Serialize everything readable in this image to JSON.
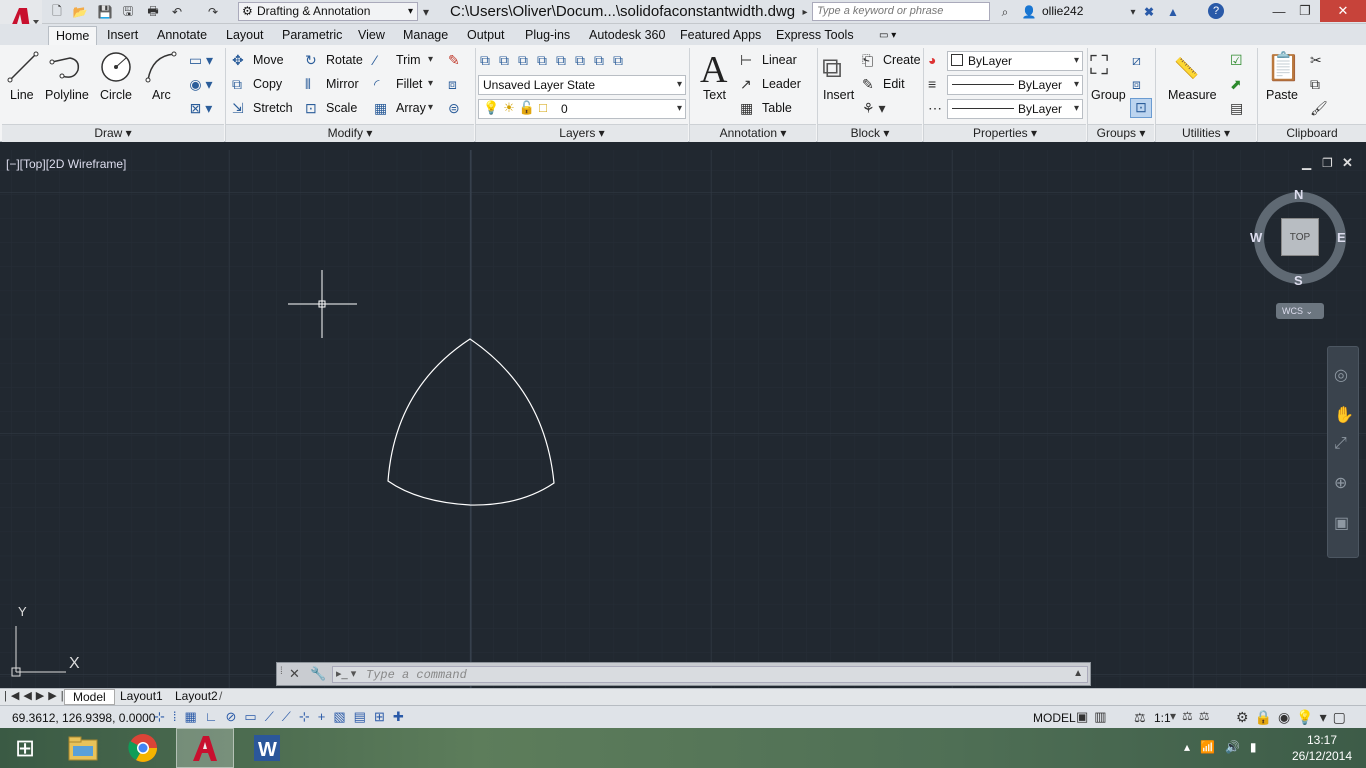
{
  "title_bar": {
    "workspace": "Drafting & Annotation",
    "file_title": "C:\\Users\\Oliver\\Docum...\\solidofaconstantwidth.dwg",
    "search_placeholder": "Type a keyword or phrase",
    "user": "ollie242"
  },
  "tabs": [
    "Home",
    "Insert",
    "Annotate",
    "Layout",
    "Parametric",
    "View",
    "Manage",
    "Output",
    "Plug-ins",
    "Autodesk 360",
    "Featured Apps",
    "Express Tools"
  ],
  "active_tab": "Home",
  "draw": {
    "line": "Line",
    "polyline": "Polyline",
    "circle": "Circle",
    "arc": "Arc",
    "footer": "Draw"
  },
  "modify": {
    "move": "Move",
    "rotate": "Rotate",
    "trim": "Trim",
    "copy": "Copy",
    "mirror": "Mirror",
    "fillet": "Fillet",
    "stretch": "Stretch",
    "scale": "Scale",
    "array": "Array",
    "footer": "Modify"
  },
  "layers": {
    "layer_state": "Unsaved Layer State",
    "layer_name": "0",
    "footer": "Layers"
  },
  "annotation": {
    "text": "Text",
    "linear": "Linear",
    "leader": "Leader",
    "table": "Table",
    "footer": "Annotation"
  },
  "block": {
    "insert": "Insert",
    "create": "Create",
    "edit": "Edit",
    "footer": "Block"
  },
  "properties": {
    "color": "ByLayer",
    "linetype": "ByLayer",
    "lineweight": "ByLayer",
    "footer": "Properties"
  },
  "groups": {
    "group": "Group",
    "footer": "Groups"
  },
  "utilities": {
    "measure": "Measure",
    "footer": "Utilities"
  },
  "clipboard": {
    "paste": "Paste",
    "footer": "Clipboard"
  },
  "viewport": {
    "label": "[−][Top][2D Wireframe]",
    "viewcube": {
      "top": "TOP",
      "n": "N",
      "s": "S",
      "e": "E",
      "w": "W",
      "wcs": "WCS"
    },
    "ucs": {
      "x": "X",
      "y": "Y"
    }
  },
  "command_line": {
    "placeholder": "Type  a  command"
  },
  "layout_tabs": [
    "Model",
    "Layout1",
    "Layout2"
  ],
  "status": {
    "coords": "69.3612, 126.9398, 0.0000",
    "model": "MODEL",
    "scale": "1:1"
  },
  "taskbar": {
    "time": "13:17",
    "date": "26/12/2014",
    "apps": [
      "file-explorer",
      "chrome",
      "autocad",
      "word"
    ]
  },
  "colors": {
    "canvas": "#212830",
    "grid": "#2c343e",
    "autocad_red": "#c8102e"
  }
}
